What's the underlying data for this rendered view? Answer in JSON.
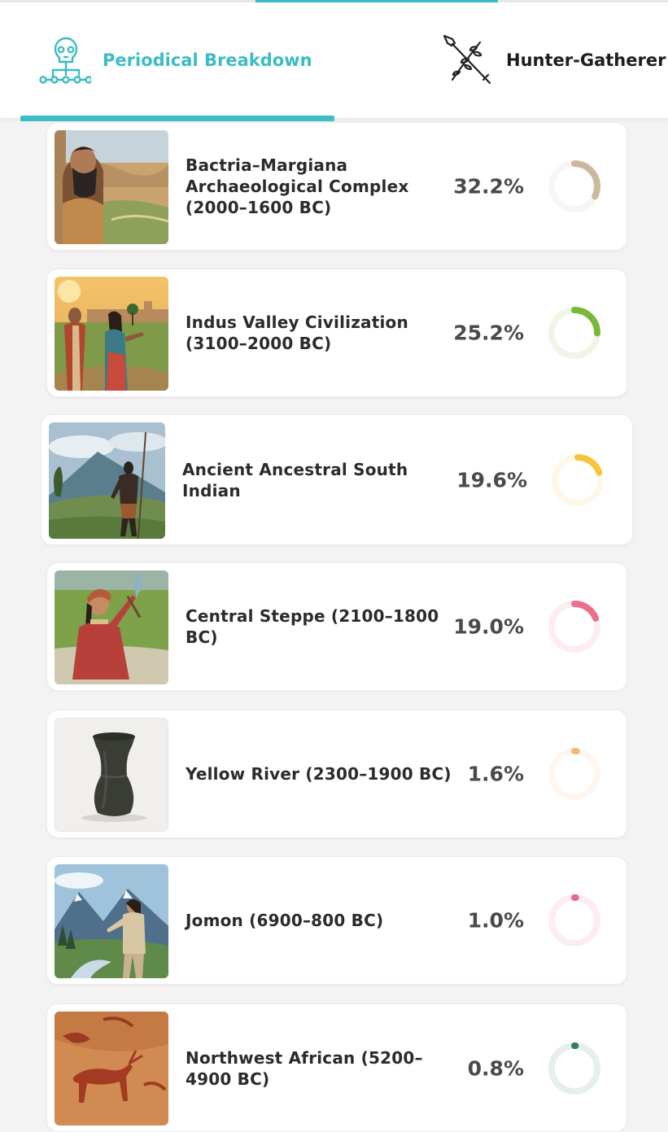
{
  "tabs": [
    {
      "label": "Periodical Breakdown",
      "active": true,
      "icon": "skull-network-icon"
    },
    {
      "label": "Hunter-Gatherer",
      "active": false,
      "icon": "spear-branch-icon"
    }
  ],
  "accent_color": "#3cbcc4",
  "items": [
    {
      "name": "Bactria–Margiana Archaeological Complex (2000–1600 BC)",
      "percent": "32.2%",
      "fraction": 0.322,
      "color": "#c9b99e",
      "image": "bearded-man-valley-portrait"
    },
    {
      "name": "Indus Valley Civilization (3100–2000 BC)",
      "percent": "25.2%",
      "fraction": 0.252,
      "color": "#79b83a",
      "image": "indus-couple-sunset-painting"
    },
    {
      "name": "Ancient Ancestral South Indian",
      "percent": "19.6%",
      "fraction": 0.196,
      "color": "#f5c542",
      "image": "hunter-with-spear-mountains"
    },
    {
      "name": "Central Steppe (2100–1800 BC)",
      "percent": "19.0%",
      "fraction": 0.19,
      "color": "#ec6f8b",
      "image": "steppe-woman-seated-painting"
    },
    {
      "name": "Yellow River (2300–1900 BC)",
      "percent": "1.6%",
      "fraction": 0.016,
      "color": "#f3b97b",
      "image": "black-pottery-vase-photo"
    },
    {
      "name": "Jomon (6900–800 BC)",
      "percent": "1.0%",
      "fraction": 0.01,
      "color": "#e7678f",
      "image": "jomon-man-mountain-painting"
    },
    {
      "name": "Northwest African (5200–4900 BC)",
      "percent": "0.8%",
      "fraction": 0.008,
      "color": "#2f7d6a",
      "image": "red-rock-art-animals"
    }
  ]
}
